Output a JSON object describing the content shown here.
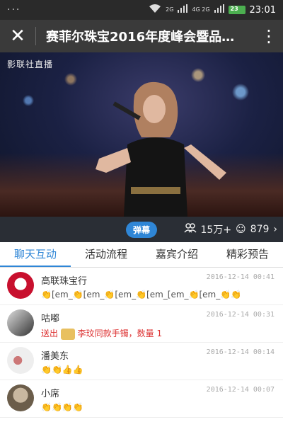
{
  "status": {
    "time": "23:01",
    "battery": "23",
    "dots": "···",
    "net1": "2G",
    "net2": "4G 2G"
  },
  "header": {
    "title": "赛菲尔珠宝2016年度峰会暨品…",
    "close_icon": "close-icon",
    "more_icon": "more-icon"
  },
  "video": {
    "watermark": "影联社直播"
  },
  "controls": {
    "danmu_label": "弹幕",
    "viewers": "15万+",
    "likes": "879"
  },
  "tabs": [
    {
      "label": "聊天互动",
      "active": true
    },
    {
      "label": "活动流程"
    },
    {
      "label": "嘉宾介绍"
    },
    {
      "label": "精彩预告"
    }
  ],
  "messages": [
    {
      "name": "高联珠宝行",
      "time": "2016-12-14 00:41",
      "content": "👏[em_👏[em_👏[em_👏[em_[em_👏[em_👏👏"
    },
    {
      "name": "咕嘟",
      "time": "2016-12-14 00:31",
      "gift_prefix": "送出",
      "gift_text": "李玟同款手镯，数量 1"
    },
    {
      "name": "潘美东",
      "time": "2016-12-14 00:14",
      "content": "👏👏👍👍"
    },
    {
      "name": "小席",
      "time": "2016-12-14 00:07",
      "content": "👏👏👏👏"
    }
  ],
  "colors": {
    "accent": "#2f86d6",
    "gift": "#d33333"
  }
}
